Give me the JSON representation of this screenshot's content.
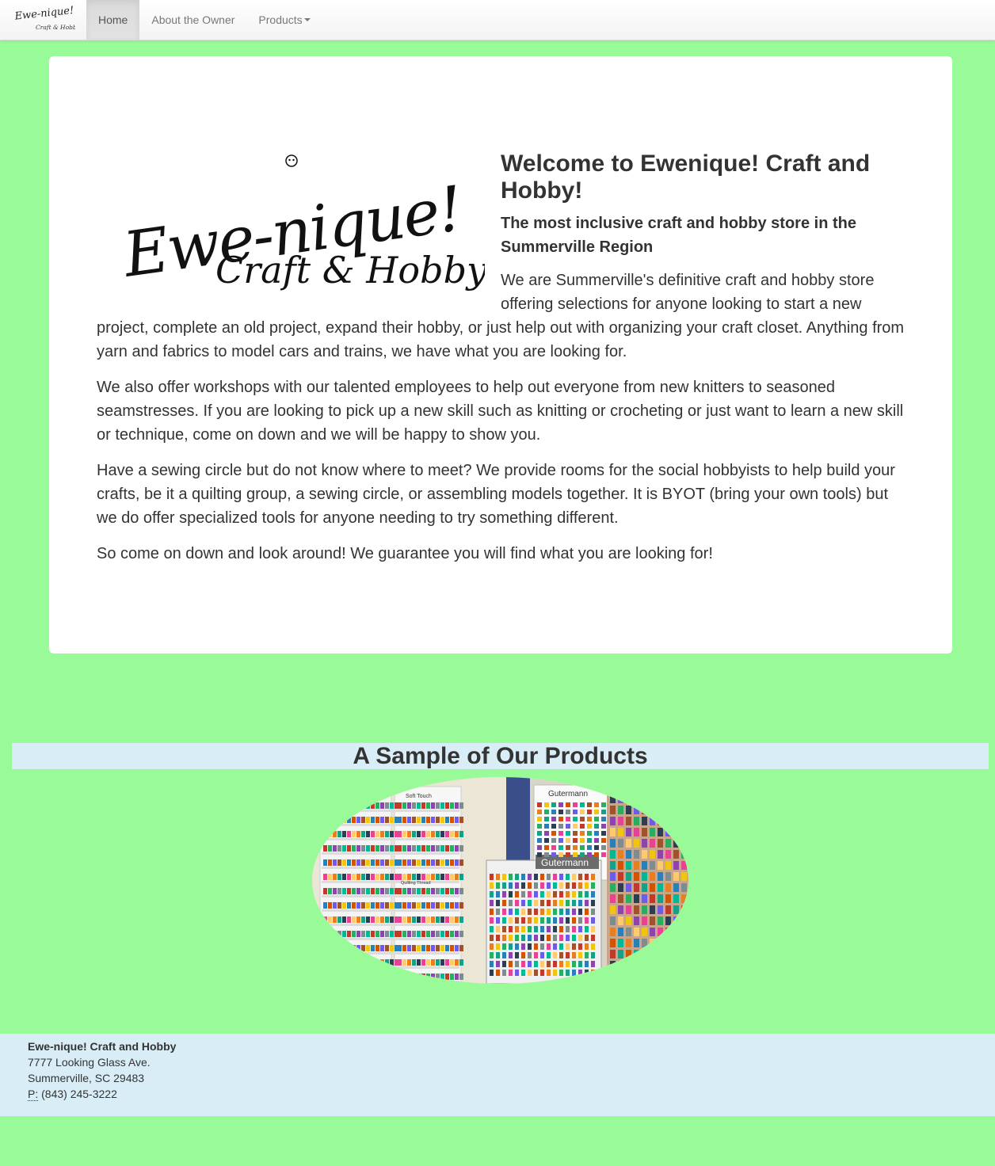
{
  "nav": {
    "brand_logo_text": "Ewe-nique! Craft & Hobby",
    "items": [
      {
        "label": "Home"
      },
      {
        "label": "About the Owner"
      },
      {
        "label": "Products"
      }
    ]
  },
  "hero": {
    "logo_text": "Ewe-nique! Craft & Hobby",
    "title": "Welcome to Ewenique! Craft and Hobby!",
    "subtitle": "The most inclusive craft and hobby store in the Summerville Region",
    "paragraphs": [
      "We are Summerville's definitive craft and hobby store offering selections for anyone looking to start a new project, complete an old project, expand their hobby, or just help out with organizing your craft closet. Anything from yarn and fabrics to model cars and trains, we have what you are looking for.",
      "We also offer workshops with our talented employees to help out everyone from new knitters to seasoned seamstresses. If you are looking to pick up a new skill such as knitting or crocheting or just want to learn a new skill or technique, come on down and we will be happy to show you.",
      "Have a sewing circle but do not know where to meet? We provide rooms for the social hobbyists to help build your crafts, be it a quilting group, a sewing circle, or assembling models together. It is BYOT (bring your own tools) but we do offer specialized tools for anyone needing to try something different.",
      "So come on down and look around! We guarantee you will find what you are looking for!"
    ]
  },
  "products": {
    "heading": "A Sample of Our Products",
    "photo_labels": [
      "Soft Touch",
      "Gutermann",
      "Gutermann",
      "Quilting Thread"
    ]
  },
  "footer": {
    "name": "Ewe-nique! Craft and Hobby",
    "street": "7777 Looking Glass Ave.",
    "city": "Summerville, SC 29483",
    "phone_abbr": "P:",
    "phone": "(843) 245-3222"
  },
  "colors": {
    "page_background": "#99fb98",
    "panel_background": "#ffffff",
    "band_background": "#d9edf7"
  }
}
